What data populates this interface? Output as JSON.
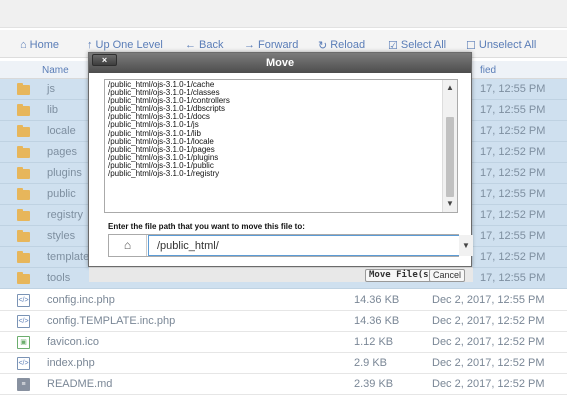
{
  "toolbar": {
    "home": "Home",
    "up_one_level": "Up One Level",
    "back": "Back",
    "forward": "Forward",
    "reload": "Reload",
    "select_all": "Select All",
    "unselect_all": "Unselect All"
  },
  "table_header": {
    "name": "Name",
    "modified": "fied"
  },
  "files_behind": [
    {
      "name": "js",
      "date": "17, 12:55 PM"
    },
    {
      "name": "lib",
      "date": "17, 12:55 PM"
    },
    {
      "name": "locale",
      "date": "17, 12:52 PM"
    },
    {
      "name": "pages",
      "date": "17, 12:52 PM"
    },
    {
      "name": "plugins",
      "date": "17, 12:52 PM"
    },
    {
      "name": "public",
      "date": "17, 12:55 PM"
    },
    {
      "name": "registry",
      "date": "17, 12:52 PM"
    },
    {
      "name": "styles",
      "date": "17, 12:55 PM"
    },
    {
      "name": "template",
      "date": "17, 12:52 PM"
    },
    {
      "name": "tools",
      "date": "17, 12:55 PM"
    }
  ],
  "files": [
    {
      "name": "config.inc.php",
      "size": "14.36 KB",
      "date": "Dec 2, 2017, 12:55 PM",
      "type": "php"
    },
    {
      "name": "config.TEMPLATE.inc.php",
      "size": "14.36 KB",
      "date": "Dec 2, 2017, 12:52 PM",
      "type": "php"
    },
    {
      "name": "favicon.ico",
      "size": "1.12 KB",
      "date": "Dec 2, 2017, 12:52 PM",
      "type": "img"
    },
    {
      "name": "index.php",
      "size": "2.9 KB",
      "date": "Dec 2, 2017, 12:52 PM",
      "type": "php"
    },
    {
      "name": "README.md",
      "size": "2.39 KB",
      "date": "Dec 2, 2017, 12:52 PM",
      "type": "doc"
    }
  ],
  "modal": {
    "title": "Move",
    "close": "×",
    "directories": [
      "/public_html/ojs-3.1.0-1/cache",
      "/public_html/ojs-3.1.0-1/classes",
      "/public_html/ojs-3.1.0-1/controllers",
      "/public_html/ojs-3.1.0-1/dbscripts",
      "/public_html/ojs-3.1.0-1/docs",
      "/public_html/ojs-3.1.0-1/js",
      "/public_html/ojs-3.1.0-1/lib",
      "/public_html/ojs-3.1.0-1/locale",
      "/public_html/ojs-3.1.0-1/pages",
      "/public_html/ojs-3.1.0-1/plugins",
      "/public_html/ojs-3.1.0-1/public",
      "/public_html/ojs-3.1.0-1/registry"
    ],
    "dest_label": "Enter the file path that you want to move this file to:",
    "dest_value": "/public_html/",
    "move_button": "Move File(s)",
    "cancel_button": "Cancel"
  }
}
